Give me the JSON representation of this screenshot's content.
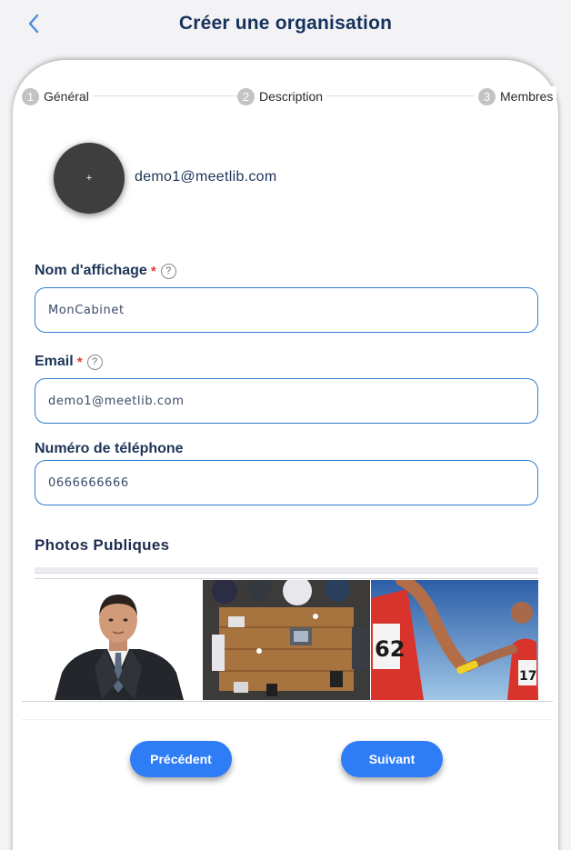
{
  "header": {
    "title": "Créer une organisation",
    "back_icon": "chevron-left-icon"
  },
  "stepper": {
    "steps": [
      {
        "num": "1",
        "label": "Général"
      },
      {
        "num": "2",
        "label": "Description"
      },
      {
        "num": "3",
        "label": "Membres"
      }
    ]
  },
  "profile": {
    "avatar_label": "+",
    "email": "demo1@meetlib.com"
  },
  "form": {
    "display_name": {
      "label": "Nom d'affichage",
      "required": "*",
      "help": "?",
      "value": "MonCabinet"
    },
    "email": {
      "label": "Email",
      "required": "*",
      "help": "?",
      "value": "demo1@meetlib.com"
    },
    "phone": {
      "label": "Numéro de téléphone",
      "value": "0666666666"
    }
  },
  "photos": {
    "title": "Photos Publiques",
    "items": [
      "businessman-photo",
      "meeting-table-photo",
      "relay-race-photo"
    ]
  },
  "actions": {
    "previous": "Précédent",
    "next": "Suivant"
  },
  "colors": {
    "accent": "#2e7cf6",
    "title": "#16325c",
    "border": "#2f7fd1",
    "required": "#e53935"
  }
}
